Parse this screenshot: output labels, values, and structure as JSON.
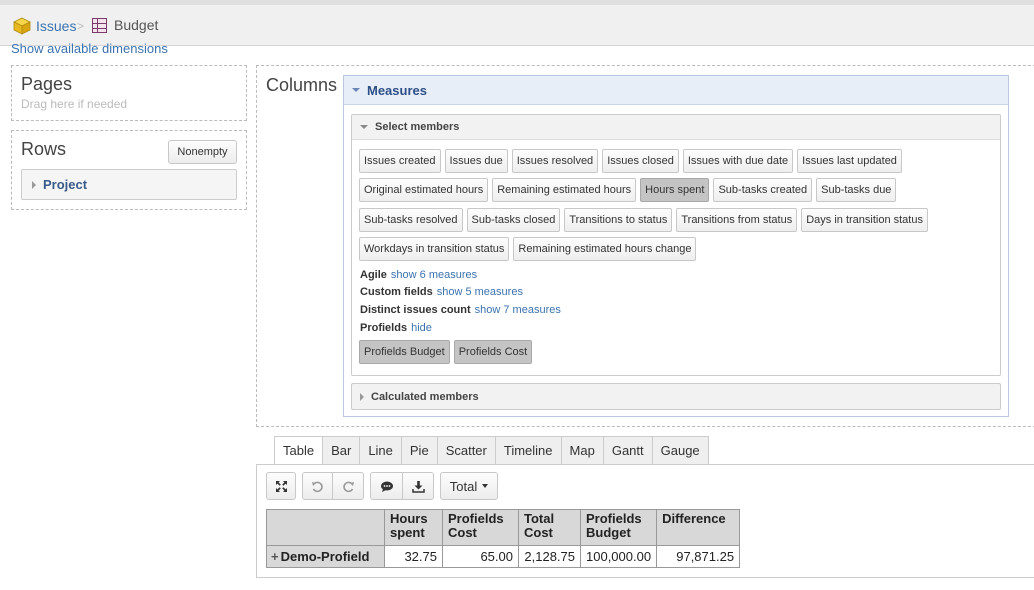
{
  "breadcrumb": {
    "issues": "Issues",
    "budget": "Budget",
    "separator": ">"
  },
  "show_dimensions_link": "Show available dimensions",
  "pages": {
    "title": "Pages",
    "hint": "Drag here if needed"
  },
  "rows": {
    "title": "Rows",
    "nonempty_button": "Nonempty",
    "items": [
      "Project"
    ]
  },
  "columns": {
    "title": "Columns",
    "measures_title": "Measures",
    "select_members_title": "Select members",
    "chip_rows": [
      [
        {
          "label": "Issues created",
          "selected": false
        },
        {
          "label": "Issues due",
          "selected": false
        },
        {
          "label": "Issues resolved",
          "selected": false
        },
        {
          "label": "Issues closed",
          "selected": false
        },
        {
          "label": "Issues with due date",
          "selected": false
        },
        {
          "label": "Issues last updated",
          "selected": false
        }
      ],
      [
        {
          "label": "Original estimated hours",
          "selected": false
        },
        {
          "label": "Remaining estimated hours",
          "selected": false
        },
        {
          "label": "Hours spent",
          "selected": true
        },
        {
          "label": "Sub-tasks created",
          "selected": false
        },
        {
          "label": "Sub-tasks due",
          "selected": false
        }
      ],
      [
        {
          "label": "Sub-tasks resolved",
          "selected": false
        },
        {
          "label": "Sub-tasks closed",
          "selected": false
        },
        {
          "label": "Transitions to status",
          "selected": false
        },
        {
          "label": "Transitions from status",
          "selected": false
        },
        {
          "label": "Days in transition status",
          "selected": false
        }
      ],
      [
        {
          "label": "Workdays in transition status",
          "selected": false
        },
        {
          "label": "Remaining estimated hours change",
          "selected": false
        }
      ]
    ],
    "groups": [
      {
        "name": "Agile",
        "link": "show 6 measures"
      },
      {
        "name": "Custom fields",
        "link": "show 5 measures"
      },
      {
        "name": "Distinct issues count",
        "link": "show 7 measures"
      },
      {
        "name": "Profields",
        "link": "hide"
      }
    ],
    "profields_chips": [
      {
        "label": "Profields Budget",
        "selected": true
      },
      {
        "label": "Profields Cost",
        "selected": true
      }
    ],
    "calculated_members_title": "Calculated members"
  },
  "tabs": [
    {
      "label": "Table",
      "active": true
    },
    {
      "label": "Bar",
      "active": false
    },
    {
      "label": "Line",
      "active": false
    },
    {
      "label": "Pie",
      "active": false
    },
    {
      "label": "Scatter",
      "active": false
    },
    {
      "label": "Timeline",
      "active": false
    },
    {
      "label": "Map",
      "active": false
    },
    {
      "label": "Gantt",
      "active": false
    },
    {
      "label": "Gauge",
      "active": false
    }
  ],
  "toolbar": {
    "total_label": "Total"
  },
  "table": {
    "headers": [
      [
        "Hours",
        "spent"
      ],
      [
        "Profields",
        "Cost"
      ],
      [
        "Total",
        "Cost"
      ],
      [
        "Profields",
        "Budget"
      ],
      [
        "Difference",
        ""
      ]
    ],
    "rows": [
      {
        "label": "Demo-Profield",
        "values": [
          "32.75",
          "65.00",
          "2,128.75",
          "100,000.00",
          "97,871.25"
        ]
      }
    ]
  },
  "colors": {
    "link": "#3b73af",
    "selected_chip": "#c4c4c4",
    "header_bg": "#d8d8d8"
  }
}
